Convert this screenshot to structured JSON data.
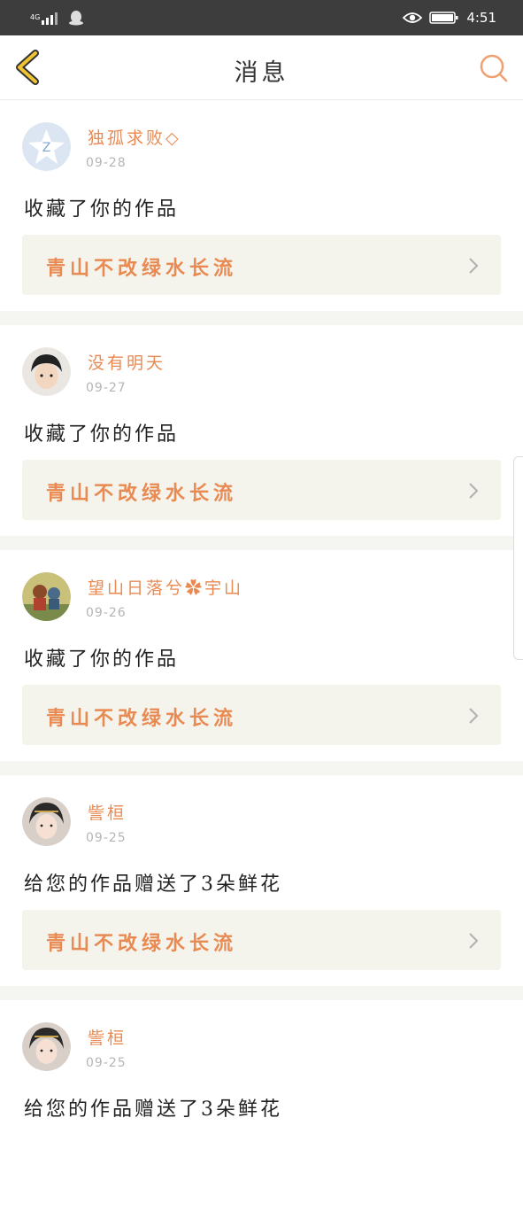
{
  "status_bar": {
    "network": "4G",
    "time": "4:51",
    "icons": [
      "signal-icon",
      "qq-penguin-icon",
      "eye-icon",
      "battery-icon"
    ]
  },
  "header": {
    "title": "消息",
    "back_icon": "chevron-left-icon",
    "search_icon": "search-icon"
  },
  "colors": {
    "accent": "#e98a52",
    "back_arrow": "#f1c232",
    "card_bg": "#f4f3ec",
    "status_bar": "#3d3d3d"
  },
  "notifications": [
    {
      "user": "独孤求败◇",
      "date": "09-28",
      "message": "收藏了你的作品",
      "work_title": "青山不改绿水长流",
      "avatar": "default-qzone-avatar"
    },
    {
      "user": "没有明天",
      "date": "09-27",
      "message": "收藏了你的作品",
      "work_title": "青山不改绿水长流",
      "avatar": "boy-photo-avatar"
    },
    {
      "user": "望山日落兮✿宇山",
      "date": "09-26",
      "message": "收藏了你的作品",
      "work_title": "青山不改绿水长流",
      "avatar": "cartoon-avatar"
    },
    {
      "user": "訾桓",
      "date": "09-25",
      "message": "给您的作品赠送了3朵鲜花",
      "work_title": "青山不改绿水长流",
      "avatar": "costume-lady-avatar"
    },
    {
      "user": "訾桓",
      "date": "09-25",
      "message": "给您的作品赠送了3朵鲜花",
      "work_title": "",
      "avatar": "costume-lady-avatar"
    }
  ]
}
